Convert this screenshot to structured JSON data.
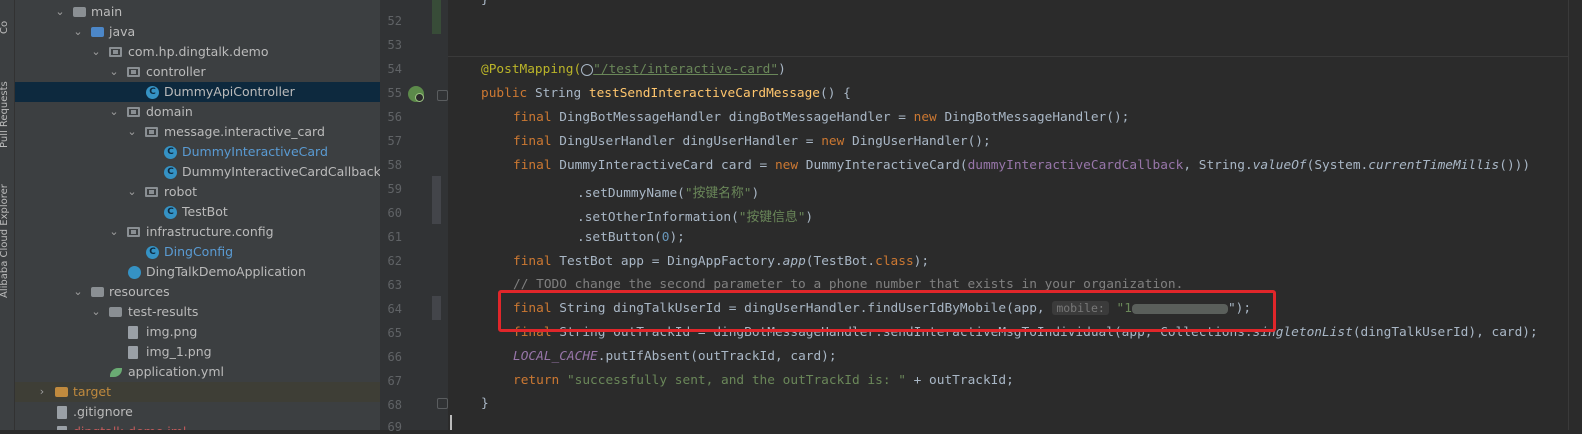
{
  "sidebar": {
    "tabs": [
      "Co",
      "Pull Requests",
      "Alibaba Cloud Explorer"
    ]
  },
  "project_tree": [
    {
      "label": "main",
      "icon": "folder-icon"
    },
    {
      "label": "java",
      "icon": "source-folder-icon"
    },
    {
      "label": "com.hp.dingtalk.demo",
      "icon": "package-icon"
    },
    {
      "label": "controller",
      "icon": "package-icon"
    },
    {
      "label": "DummyApiController",
      "icon": "class-icon"
    },
    {
      "label": "domain",
      "icon": "package-icon"
    },
    {
      "label": "message.interactive_card",
      "icon": "package-icon"
    },
    {
      "label": "DummyInteractiveCard",
      "icon": "class-icon"
    },
    {
      "label": "DummyInteractiveCardCallback",
      "icon": "class-icon"
    },
    {
      "label": "robot",
      "icon": "package-icon"
    },
    {
      "label": "TestBot",
      "icon": "class-icon"
    },
    {
      "label": "infrastructure.config",
      "icon": "package-icon"
    },
    {
      "label": "DingConfig",
      "icon": "class-icon"
    },
    {
      "label": "DingTalkDemoApplication",
      "icon": "spring-app-icon"
    },
    {
      "label": "resources",
      "icon": "resources-folder-icon"
    },
    {
      "label": "test-results",
      "icon": "folder-icon"
    },
    {
      "label": "img.png",
      "icon": "image-file-icon"
    },
    {
      "label": "img_1.png",
      "icon": "image-file-icon"
    },
    {
      "label": "application.yml",
      "icon": "yaml-file-icon"
    },
    {
      "label": "target",
      "icon": "excluded-folder-icon"
    },
    {
      "label": ".gitignore",
      "icon": "file-icon"
    },
    {
      "label": "dingtalk-demo.iml",
      "icon": "file-icon"
    }
  ],
  "editor": {
    "line_numbers": [
      "52",
      "53",
      "54",
      "55",
      "56",
      "57",
      "58",
      "59",
      "60",
      "61",
      "62",
      "63",
      "64",
      "65",
      "66",
      "67",
      "68",
      "69"
    ],
    "lines": {
      "l51": "}",
      "l54_ann": "@PostMapping(",
      "l54_url": "\"/test/interactive-card\"",
      "l54_close": ")",
      "l55_kw": "public",
      "l55_type": " String ",
      "l55_fn": "testSendInteractiveCardMessage",
      "l55_rest": "() {",
      "l56_kw": "final",
      "l56_a": " DingBotMessageHandler dingBotMessageHandler = ",
      "l56_new": "new",
      "l56_b": " DingBotMessageHandler();",
      "l57_kw": "final",
      "l57_a": " DingUserHandler dingUserHandler = ",
      "l57_new": "new",
      "l57_b": " DingUserHandler();",
      "l58_kw": "final",
      "l58_a": " DummyInteractiveCard card = ",
      "l58_new": "new",
      "l58_b": " DummyInteractiveCard(",
      "l58_field": "dummyInteractiveCardCallback",
      "l58_c": ", String.",
      "l58_m1": "valueOf",
      "l58_d": "(System.",
      "l58_m2": "currentTimeMillis",
      "l58_e": "()))",
      "l59_a": ".setDummyName(",
      "l59_str": "\"按键名称\"",
      "l59_b": ")",
      "l60_a": ".setOtherInformation(",
      "l60_str": "\"按键信息\"",
      "l60_b": ")",
      "l61_a": ".setButton(",
      "l61_num": "0",
      "l61_b": ");",
      "l62_kw": "final",
      "l62_a": " TestBot app = DingAppFactory.",
      "l62_m": "app",
      "l62_b": "(TestBot.",
      "l62_cls": "class",
      "l62_c": ");",
      "l63_cmt": "// TODO change the second parameter to a phone number that exists in your organization.",
      "l64_kw": "final",
      "l64_a": " String dingTalkUserId = dingUserHandler.findUserIdByMobile(app, ",
      "l64_hint": "mobile:",
      "l64_str": "\"1",
      "l64_b": "\");",
      "l65_kw": "final",
      "l65_a": " String outTrackId = dingBotMessageHandler.sendInteractiveMsgToIndividual(app, Collections.",
      "l65_m": "singletonList",
      "l65_b": "(dingTalkUserId), card);",
      "l66_field": "LOCAL_CACHE",
      "l66_a": ".putIfAbsent(outTrackId, card);",
      "l67_kw": "return",
      "l67_str": " \"successfully sent, and the outTrackId is: \"",
      "l67_a": " + outTrackId;",
      "l68": "}"
    }
  },
  "colors": {
    "keyword": "#cc7832",
    "string": "#6a8759",
    "annotation": "#bbb529",
    "function": "#ffc66d",
    "number": "#6897bb",
    "field": "#9876aa",
    "highlight_box": "#e0262a"
  }
}
